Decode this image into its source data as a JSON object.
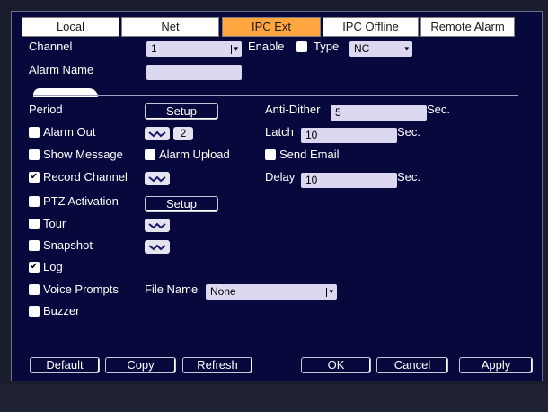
{
  "tabs": [
    {
      "label": "Local",
      "active": false
    },
    {
      "label": "Net",
      "active": false
    },
    {
      "label": "IPC Ext",
      "active": true
    },
    {
      "label": "IPC Offline",
      "active": false
    },
    {
      "label": "Remote Alarm",
      "active": false
    }
  ],
  "channel": {
    "label": "Channel",
    "value": "1"
  },
  "enable": {
    "label": "Enable",
    "checked": false
  },
  "type": {
    "label": "Type",
    "value": "NC"
  },
  "alarm_name": {
    "label": "Alarm Name",
    "value": ""
  },
  "period": {
    "label": "Period",
    "button": "Setup"
  },
  "anti_dither": {
    "label": "Anti-Dither",
    "value": "5",
    "unit": "Sec."
  },
  "alarm_out": {
    "label": "Alarm Out",
    "checked": false,
    "badge": "2"
  },
  "latch": {
    "label": "Latch",
    "value": "10",
    "unit": "Sec."
  },
  "show_message": {
    "label": "Show Message",
    "checked": false
  },
  "alarm_upload": {
    "label": "Alarm Upload",
    "checked": false
  },
  "send_email": {
    "label": "Send Email",
    "checked": false
  },
  "record_channel": {
    "label": "Record Channel",
    "checked": true
  },
  "delay": {
    "label": "Delay",
    "value": "10",
    "unit": "Sec."
  },
  "ptz_activation": {
    "label": "PTZ Activation",
    "checked": false,
    "button": "Setup"
  },
  "tour": {
    "label": "Tour",
    "checked": false
  },
  "snapshot": {
    "label": "Snapshot",
    "checked": false
  },
  "log": {
    "label": "Log",
    "checked": true
  },
  "voice_prompts": {
    "label": "Voice Prompts",
    "checked": false,
    "file_label": "File Name",
    "file_value": "None"
  },
  "buzzer": {
    "label": "Buzzer",
    "checked": false
  },
  "footer": {
    "default": "Default",
    "copy": "Copy",
    "refresh": "Refresh",
    "ok": "OK",
    "cancel": "Cancel",
    "apply": "Apply"
  },
  "colors": {
    "background": "#07083c",
    "active_tab": "#ffa640",
    "field": "#dcd8f2"
  },
  "icons": {
    "checkmark": "✔",
    "dropdown": "chevron-down-icon",
    "setting": "setting-icon"
  }
}
